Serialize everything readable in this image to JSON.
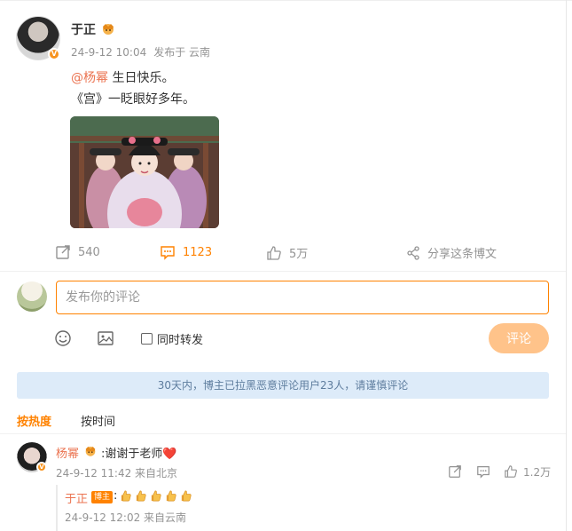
{
  "post": {
    "author": "于正",
    "timestamp": "24-9-12 10:04",
    "source": "发布于 云南",
    "mention": "@杨幂",
    "line1_text": " 生日快乐。",
    "line2_text": "《宫》一眨眼好多年。"
  },
  "actions": {
    "repost_count": "540",
    "comment_count": "1123",
    "like_count": "5万",
    "share_label": "分享这条博文"
  },
  "composer": {
    "placeholder": "发布你的评论",
    "repost_label": "同时转发",
    "submit_label": "评论"
  },
  "notice": "30天内，博主已拉黑恶意评论用户23人，请谨慎评论",
  "sort": {
    "hot": "按热度",
    "time": "按时间"
  },
  "comments": [
    {
      "name": "杨幂",
      "text": ":谢谢于老师❤️",
      "meta": "24-9-12 11:42 来自北京",
      "likes": "1.2万",
      "reply": {
        "name": "于正",
        "badge": "博主",
        "colon": ":",
        "emoji_count": 5,
        "meta": "24-9-12 12:02 来自云南"
      }
    }
  ],
  "colors": {
    "accent": "#ff8200",
    "link": "#eb7350",
    "notice_bg": "#ddebf9",
    "submit_disabled": "#ffc38a"
  },
  "icons": [
    "repost-icon",
    "comment-icon",
    "like-icon",
    "share-icon",
    "emoji-icon",
    "image-icon",
    "crown-icon",
    "verified-icon"
  ]
}
